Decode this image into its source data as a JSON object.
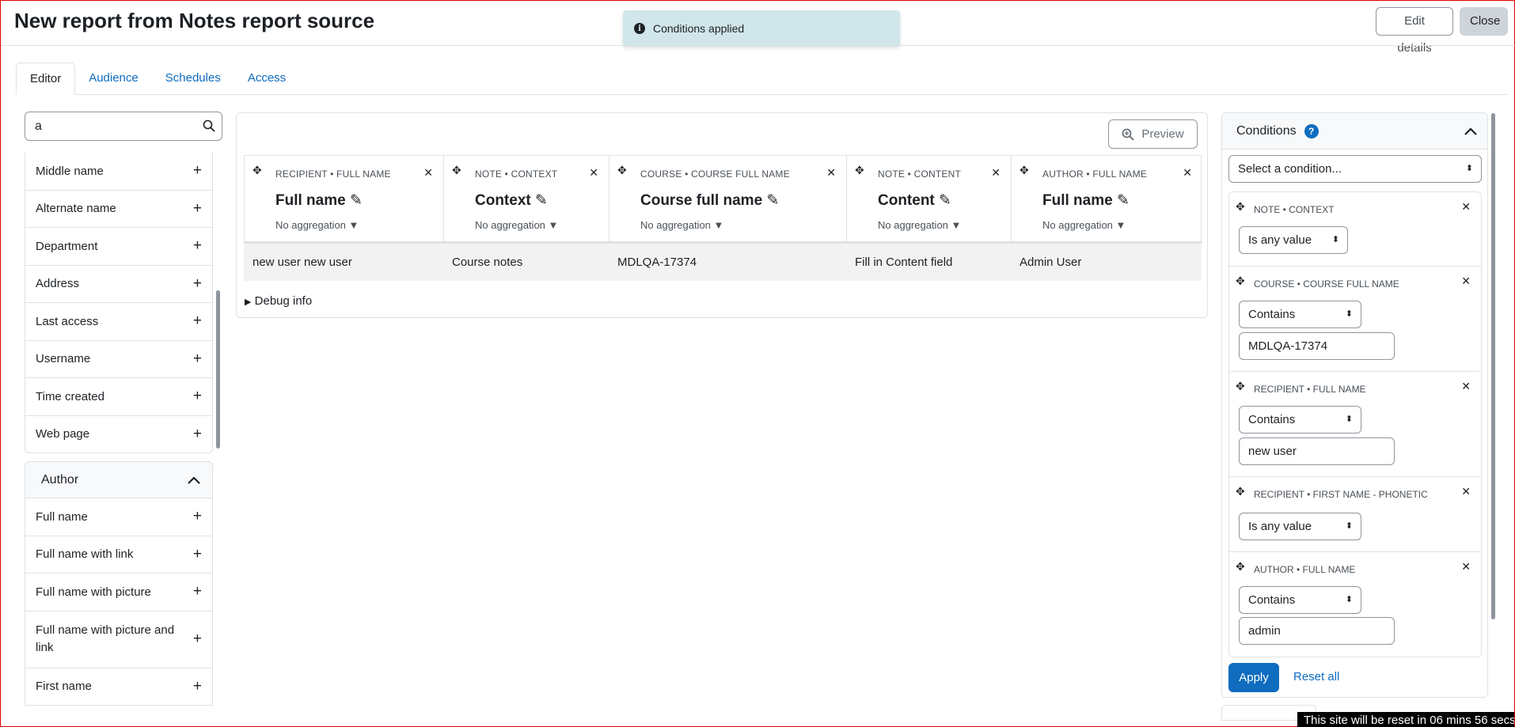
{
  "header": {
    "title": "New report from Notes report source",
    "edit_details": "Edit details",
    "close": "Close"
  },
  "toast": {
    "message": "Conditions applied"
  },
  "tabs": [
    {
      "label": "Editor",
      "active": true
    },
    {
      "label": "Audience"
    },
    {
      "label": "Schedules"
    },
    {
      "label": "Access"
    }
  ],
  "sidebar": {
    "search_value": "a",
    "items": [
      {
        "label": "Middle name"
      },
      {
        "label": "Alternate name"
      },
      {
        "label": "Department"
      },
      {
        "label": "Address"
      },
      {
        "label": "Last access"
      },
      {
        "label": "Username"
      },
      {
        "label": "Time created"
      },
      {
        "label": "Web page"
      }
    ],
    "author_group": {
      "title": "Author",
      "items": [
        {
          "label": "Full name"
        },
        {
          "label": "Full name with link"
        },
        {
          "label": "Full name with picture"
        },
        {
          "label": "Full name with picture and link"
        },
        {
          "label": "First name"
        }
      ]
    },
    "plus": "+"
  },
  "main": {
    "preview": "Preview",
    "columns": [
      {
        "caption": "RECIPIENT • FULL NAME",
        "title": "Full name",
        "aggregation": "No aggregation",
        "value": "new user new user"
      },
      {
        "caption": "NOTE • CONTEXT",
        "title": "Context",
        "aggregation": "No aggregation",
        "value": "Course notes"
      },
      {
        "caption": "COURSE • COURSE FULL NAME",
        "title": "Course full name",
        "aggregation": "No aggregation",
        "value": "MDLQA-17374"
      },
      {
        "caption": "NOTE • CONTENT",
        "title": "Content",
        "aggregation": "No aggregation",
        "value": "Fill in Content field"
      },
      {
        "caption": "AUTHOR • FULL NAME",
        "title": "Full name",
        "aggregation": "No aggregation",
        "value": "Admin User"
      }
    ],
    "debug": "Debug info"
  },
  "conditions": {
    "title": "Conditions",
    "select_placeholder": "Select a condition...",
    "items": [
      {
        "caption": "NOTE • CONTEXT",
        "operator": "Is any value",
        "value": null
      },
      {
        "caption": "COURSE • COURSE FULL NAME",
        "operator": "Contains",
        "value": "MDLQA-17374"
      },
      {
        "caption": "RECIPIENT • FULL NAME",
        "operator": "Contains",
        "value": "new user"
      },
      {
        "caption": "RECIPIENT • FIRST NAME - PHONETIC",
        "operator": "Is any value",
        "value": null
      },
      {
        "caption": "AUTHOR • FULL NAME",
        "operator": "Contains",
        "value": "admin"
      }
    ],
    "apply": "Apply",
    "reset_all": "Reset all"
  },
  "banner": {
    "text": "This site will be reset in 06 mins 56 secs"
  },
  "colors": {
    "link": "#0f6cbf",
    "primary": "#0f6cbf",
    "toast_bg": "#d0e6ea",
    "row_bg": "#f2f2f2"
  }
}
